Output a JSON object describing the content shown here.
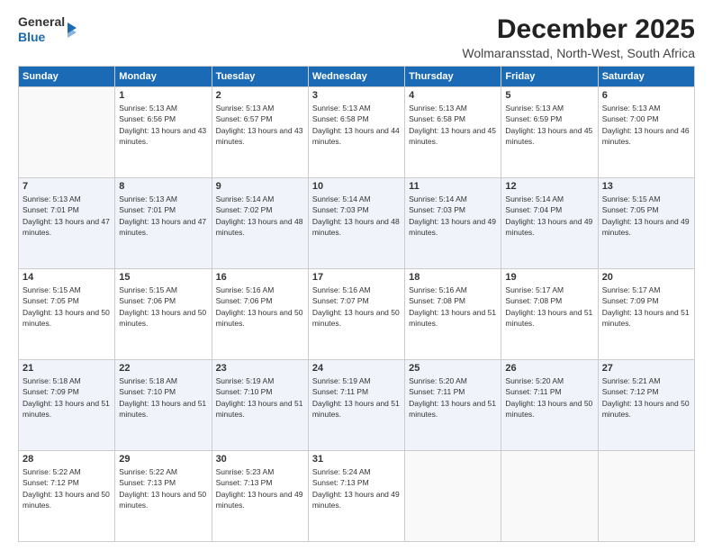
{
  "header": {
    "logo_general": "General",
    "logo_blue": "Blue",
    "month": "December 2025",
    "location": "Wolmaransstad, North-West, South Africa"
  },
  "weekdays": [
    "Sunday",
    "Monday",
    "Tuesday",
    "Wednesday",
    "Thursday",
    "Friday",
    "Saturday"
  ],
  "weeks": [
    [
      {
        "day": null,
        "content": null
      },
      {
        "day": "1",
        "sunrise": "5:13 AM",
        "sunset": "6:56 PM",
        "daylight": "13 hours and 43 minutes."
      },
      {
        "day": "2",
        "sunrise": "5:13 AM",
        "sunset": "6:57 PM",
        "daylight": "13 hours and 43 minutes."
      },
      {
        "day": "3",
        "sunrise": "5:13 AM",
        "sunset": "6:58 PM",
        "daylight": "13 hours and 44 minutes."
      },
      {
        "day": "4",
        "sunrise": "5:13 AM",
        "sunset": "6:58 PM",
        "daylight": "13 hours and 45 minutes."
      },
      {
        "day": "5",
        "sunrise": "5:13 AM",
        "sunset": "6:59 PM",
        "daylight": "13 hours and 45 minutes."
      },
      {
        "day": "6",
        "sunrise": "5:13 AM",
        "sunset": "7:00 PM",
        "daylight": "13 hours and 46 minutes."
      }
    ],
    [
      {
        "day": "7",
        "sunrise": "5:13 AM",
        "sunset": "7:01 PM",
        "daylight": "13 hours and 47 minutes."
      },
      {
        "day": "8",
        "sunrise": "5:13 AM",
        "sunset": "7:01 PM",
        "daylight": "13 hours and 47 minutes."
      },
      {
        "day": "9",
        "sunrise": "5:14 AM",
        "sunset": "7:02 PM",
        "daylight": "13 hours and 48 minutes."
      },
      {
        "day": "10",
        "sunrise": "5:14 AM",
        "sunset": "7:03 PM",
        "daylight": "13 hours and 48 minutes."
      },
      {
        "day": "11",
        "sunrise": "5:14 AM",
        "sunset": "7:03 PM",
        "daylight": "13 hours and 49 minutes."
      },
      {
        "day": "12",
        "sunrise": "5:14 AM",
        "sunset": "7:04 PM",
        "daylight": "13 hours and 49 minutes."
      },
      {
        "day": "13",
        "sunrise": "5:15 AM",
        "sunset": "7:05 PM",
        "daylight": "13 hours and 49 minutes."
      }
    ],
    [
      {
        "day": "14",
        "sunrise": "5:15 AM",
        "sunset": "7:05 PM",
        "daylight": "13 hours and 50 minutes."
      },
      {
        "day": "15",
        "sunrise": "5:15 AM",
        "sunset": "7:06 PM",
        "daylight": "13 hours and 50 minutes."
      },
      {
        "day": "16",
        "sunrise": "5:16 AM",
        "sunset": "7:06 PM",
        "daylight": "13 hours and 50 minutes."
      },
      {
        "day": "17",
        "sunrise": "5:16 AM",
        "sunset": "7:07 PM",
        "daylight": "13 hours and 50 minutes."
      },
      {
        "day": "18",
        "sunrise": "5:16 AM",
        "sunset": "7:08 PM",
        "daylight": "13 hours and 51 minutes."
      },
      {
        "day": "19",
        "sunrise": "5:17 AM",
        "sunset": "7:08 PM",
        "daylight": "13 hours and 51 minutes."
      },
      {
        "day": "20",
        "sunrise": "5:17 AM",
        "sunset": "7:09 PM",
        "daylight": "13 hours and 51 minutes."
      }
    ],
    [
      {
        "day": "21",
        "sunrise": "5:18 AM",
        "sunset": "7:09 PM",
        "daylight": "13 hours and 51 minutes."
      },
      {
        "day": "22",
        "sunrise": "5:18 AM",
        "sunset": "7:10 PM",
        "daylight": "13 hours and 51 minutes."
      },
      {
        "day": "23",
        "sunrise": "5:19 AM",
        "sunset": "7:10 PM",
        "daylight": "13 hours and 51 minutes."
      },
      {
        "day": "24",
        "sunrise": "5:19 AM",
        "sunset": "7:11 PM",
        "daylight": "13 hours and 51 minutes."
      },
      {
        "day": "25",
        "sunrise": "5:20 AM",
        "sunset": "7:11 PM",
        "daylight": "13 hours and 51 minutes."
      },
      {
        "day": "26",
        "sunrise": "5:20 AM",
        "sunset": "7:11 PM",
        "daylight": "13 hours and 50 minutes."
      },
      {
        "day": "27",
        "sunrise": "5:21 AM",
        "sunset": "7:12 PM",
        "daylight": "13 hours and 50 minutes."
      }
    ],
    [
      {
        "day": "28",
        "sunrise": "5:22 AM",
        "sunset": "7:12 PM",
        "daylight": "13 hours and 50 minutes."
      },
      {
        "day": "29",
        "sunrise": "5:22 AM",
        "sunset": "7:13 PM",
        "daylight": "13 hours and 50 minutes."
      },
      {
        "day": "30",
        "sunrise": "5:23 AM",
        "sunset": "7:13 PM",
        "daylight": "13 hours and 49 minutes."
      },
      {
        "day": "31",
        "sunrise": "5:24 AM",
        "sunset": "7:13 PM",
        "daylight": "13 hours and 49 minutes."
      },
      {
        "day": null,
        "content": null
      },
      {
        "day": null,
        "content": null
      },
      {
        "day": null,
        "content": null
      }
    ]
  ]
}
